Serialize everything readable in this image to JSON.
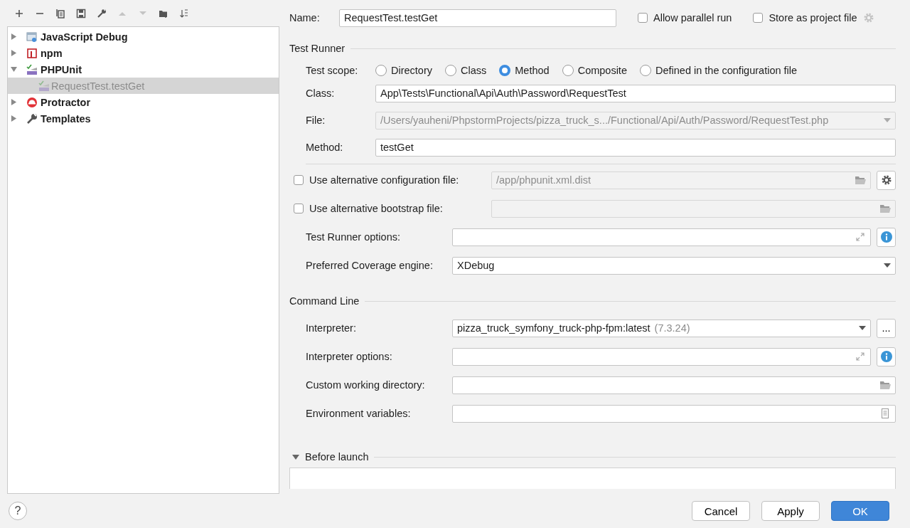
{
  "toolbar": [
    {
      "kind": "add",
      "disabled": false
    },
    {
      "kind": "remove",
      "disabled": false
    },
    {
      "kind": "copy",
      "disabled": false
    },
    {
      "kind": "save",
      "disabled": false
    },
    {
      "kind": "edit",
      "disabled": false
    },
    {
      "kind": "up",
      "disabled": true
    },
    {
      "kind": "down",
      "disabled": true
    },
    {
      "kind": "folder",
      "disabled": false
    },
    {
      "kind": "sort",
      "disabled": false
    }
  ],
  "tree": [
    {
      "label": "JavaScript Debug",
      "kind": "jsdebug",
      "expanded": false,
      "selected": false
    },
    {
      "label": "npm",
      "kind": "npm",
      "expanded": false,
      "selected": false
    },
    {
      "label": "PHPUnit",
      "kind": "phpunit",
      "expanded": true,
      "selected": false,
      "children": [
        {
          "label": "RequestTest.testGet",
          "kind": "phpunit",
          "selected": true
        }
      ]
    },
    {
      "label": "Protractor",
      "kind": "protractor",
      "expanded": false,
      "selected": false
    },
    {
      "label": "Templates",
      "kind": "templates",
      "expanded": false,
      "selected": false
    }
  ],
  "name": {
    "label": "Name:",
    "value": "RequestTest.testGet"
  },
  "options": [
    {
      "label": "Allow parallel run",
      "checked": false
    },
    {
      "label": "Store as project file",
      "checked": false
    }
  ],
  "test_runner": {
    "title": "Test Runner",
    "scope_label": "Test scope:",
    "scopes": [
      {
        "label": "Directory",
        "selected": false
      },
      {
        "label": "Class",
        "selected": false
      },
      {
        "label": "Method",
        "selected": true
      },
      {
        "label": "Composite",
        "selected": false
      },
      {
        "label": "Defined in the configuration file",
        "selected": false
      }
    ],
    "fields": [
      {
        "label": "Class:",
        "value": "App\\Tests\\Functional\\Api\\Auth\\Password\\RequestTest",
        "disabled": false,
        "kind": "text"
      },
      {
        "label": "File:",
        "value": "/Users/yauheni/PhpstormProjects/pizza_truck_s.../Functional/Api/Auth/Password/RequestTest.php",
        "disabled": true,
        "kind": "dropdown"
      },
      {
        "label": "Method:",
        "value": "testGet",
        "disabled": false,
        "kind": "text"
      }
    ],
    "extra": [
      {
        "kind": "checkfield",
        "label": "Use alternative configuration file:",
        "checked": false,
        "disabled": true,
        "value": "/app/phpunit.xml.dist",
        "settings_button": true
      },
      {
        "kind": "checkfield",
        "label": "Use alternative bootstrap file:",
        "checked": false,
        "disabled": true,
        "settings_button": false
      },
      {
        "kind": "expand",
        "label": "Test Runner options:",
        "info_button": true
      },
      {
        "kind": "dropdown",
        "label": "Preferred Coverage engine:",
        "value": "XDebug"
      }
    ]
  },
  "command_line": {
    "title": "Command Line",
    "rows": [
      {
        "kind": "interpreter",
        "label": "Interpreter:",
        "value": "pizza_truck_symfony_truck-php-fpm:latest",
        "version": "(7.3.24)",
        "button": "..."
      },
      {
        "kind": "expand",
        "label": "Interpreter options:",
        "info_button": true
      },
      {
        "kind": "folder",
        "label": "Custom working directory:"
      },
      {
        "kind": "env",
        "label": "Environment variables:"
      }
    ]
  },
  "before_launch": {
    "label": "Before launch",
    "expanded": true
  },
  "help": "?",
  "buttons": [
    {
      "label": "Cancel",
      "kind": "normal"
    },
    {
      "label": "Apply",
      "kind": "normal"
    },
    {
      "label": "OK",
      "kind": "primary"
    }
  ]
}
